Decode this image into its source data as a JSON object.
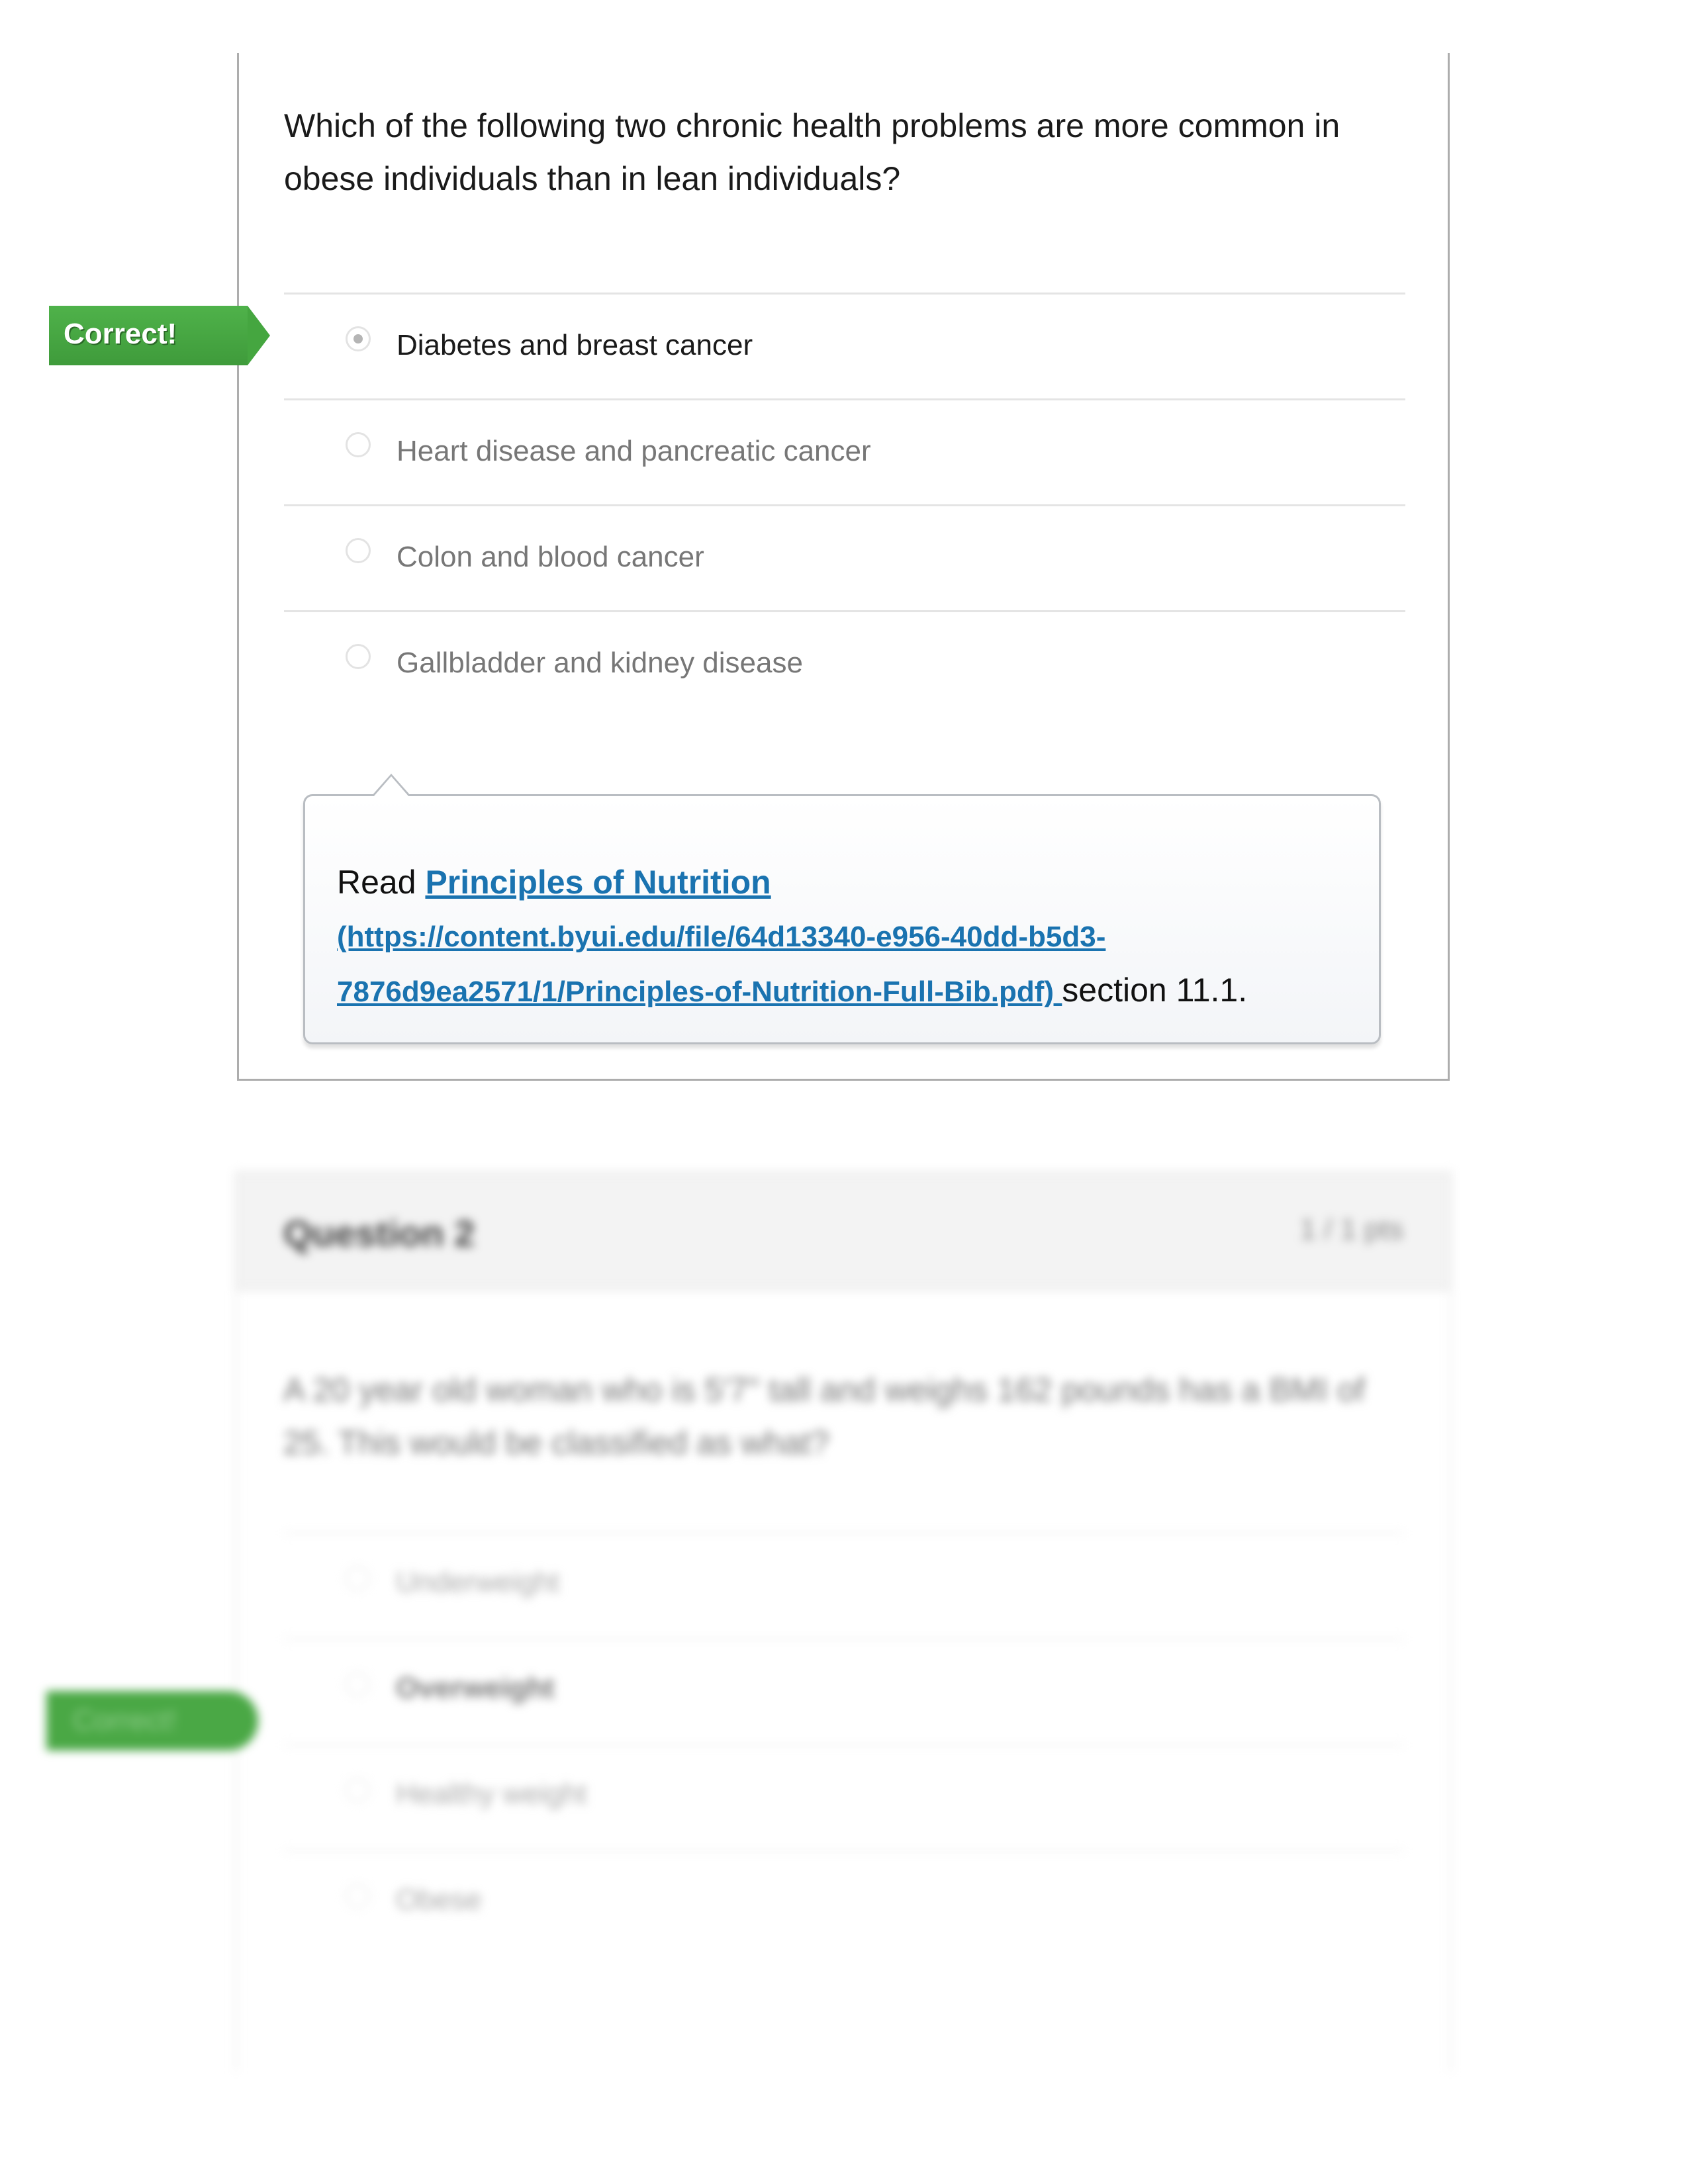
{
  "question1": {
    "text": "Which of the following two chronic health problems are more common in obese individuals than in lean individuals?",
    "result_flag": "Correct!",
    "answers": [
      {
        "label": "Diabetes and breast cancer",
        "selected": true
      },
      {
        "label": "Heart disease and pancreatic cancer",
        "selected": false
      },
      {
        "label": "Colon and blood cancer",
        "selected": false
      },
      {
        "label": "Gallbladder and kidney disease",
        "selected": false
      }
    ],
    "feedback": {
      "prefix": "Read ",
      "link_title": "Principles of Nutrition",
      "link_url_line1": "(https://content.byui.edu/file/64d13340-e956-40dd-b5d3-",
      "link_url_line2": "7876d9ea2571/1/Principles-of-Nutrition-Full-Bib.pdf) ",
      "suffix": "section 11.1."
    }
  },
  "question2": {
    "title": "Question 2",
    "points": "1 / 1 pts",
    "text": "A 20 year old woman who is 5'7\" tall and weighs 162 pounds has a BMI of 25. This would be classified as what?",
    "result_flag": "Correct!",
    "answers": [
      {
        "label": "Underweight",
        "selected": false
      },
      {
        "label": "Overweight",
        "selected": true
      },
      {
        "label": "Healthy weight",
        "selected": false
      },
      {
        "label": "Obese",
        "selected": false
      }
    ]
  },
  "colors": {
    "correct_green": "#45a640",
    "link_blue": "#1a73b0"
  }
}
